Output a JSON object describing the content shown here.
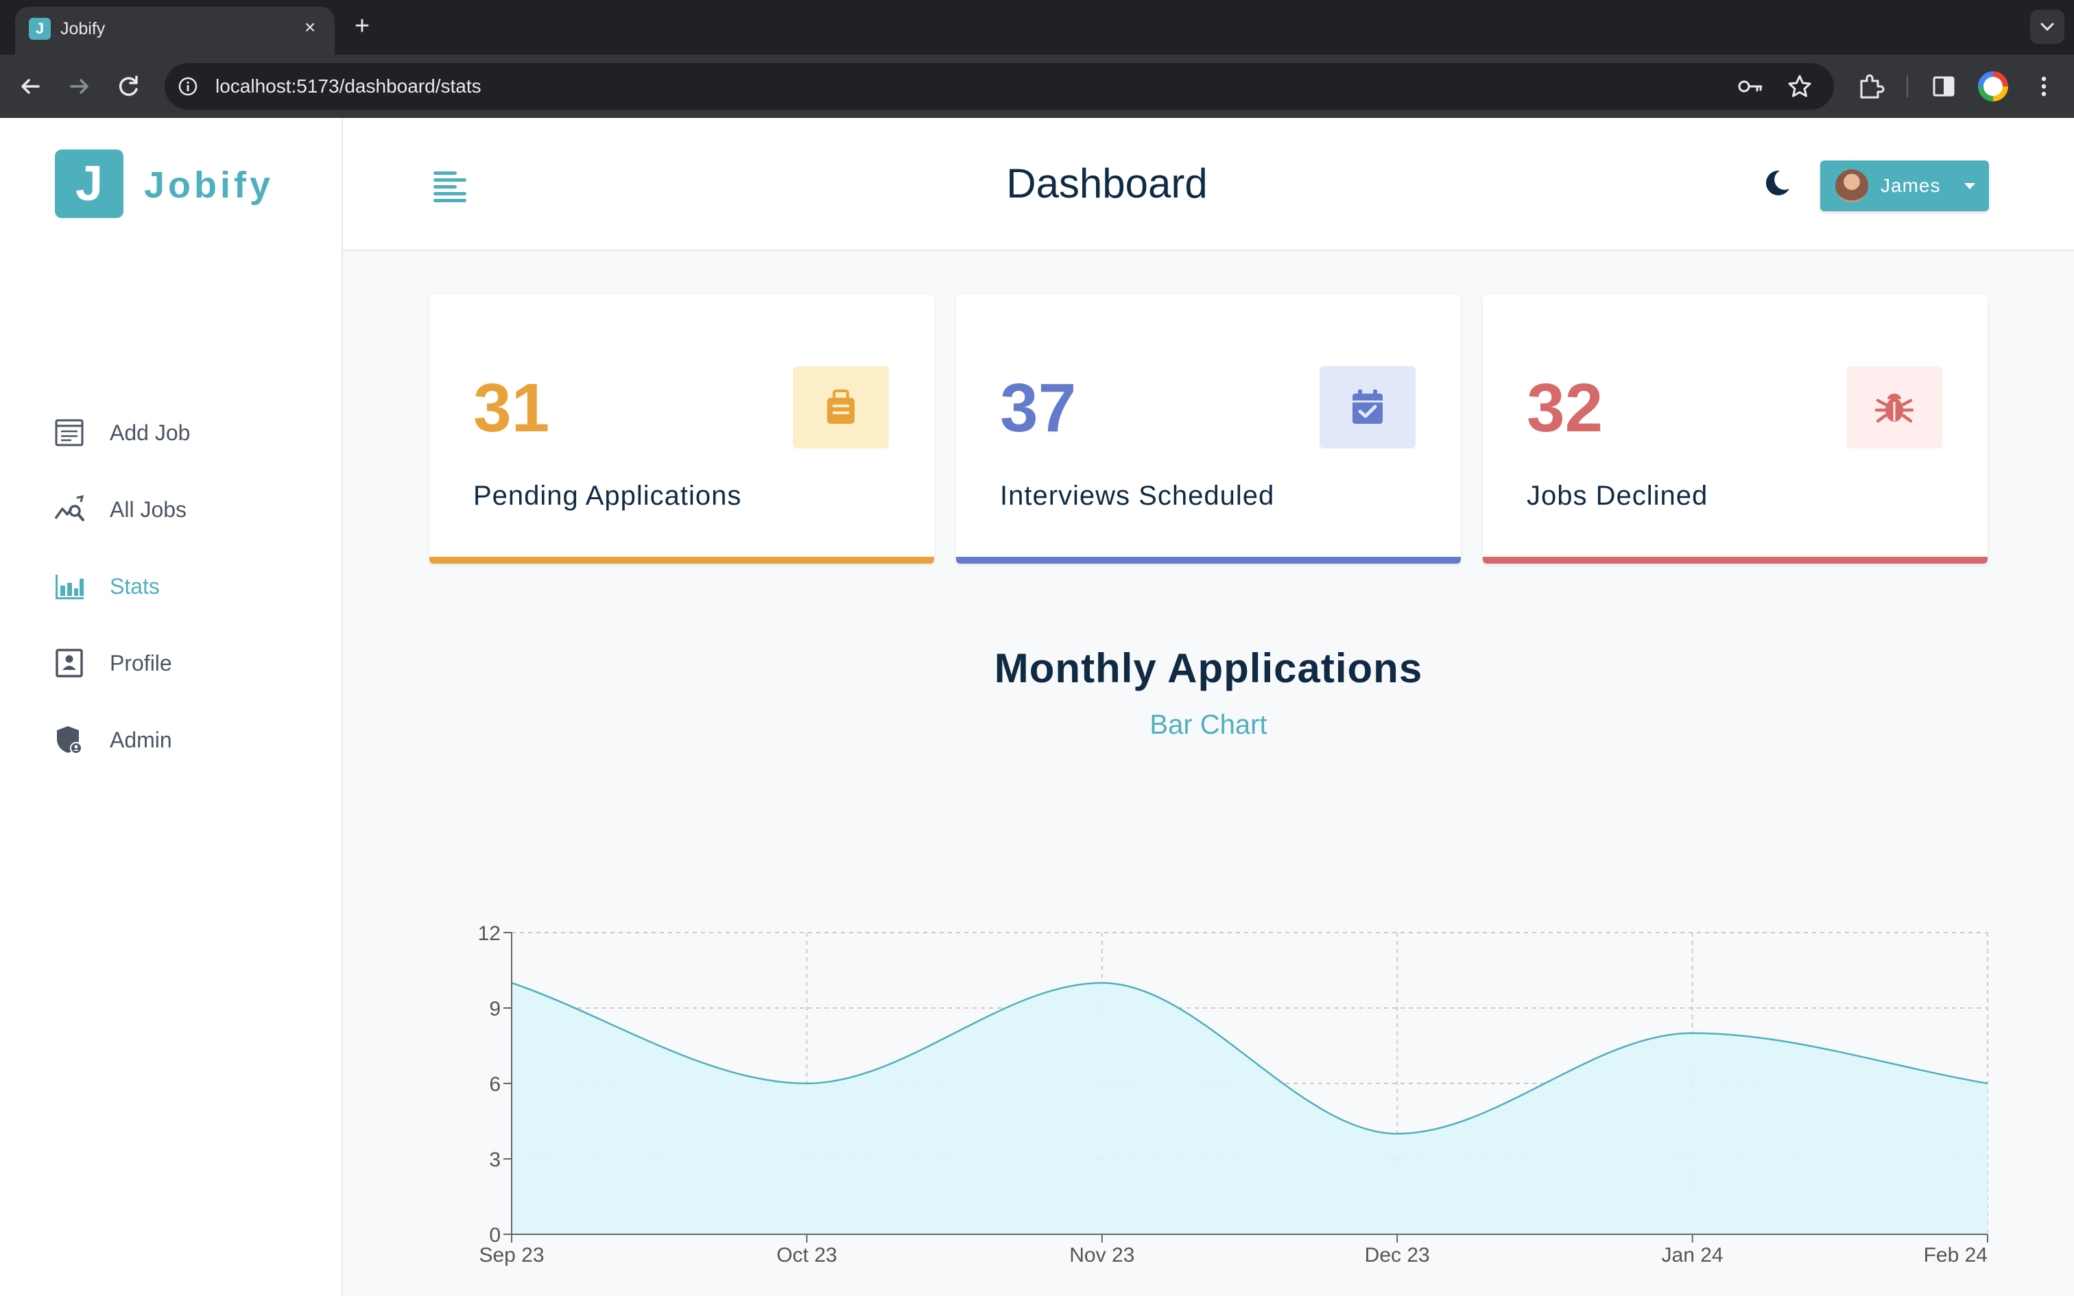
{
  "browser": {
    "tab_title": "Jobify",
    "tab_favicon_letter": "J",
    "tab_close": "×",
    "new_tab": "+",
    "url": "localhost:5173/dashboard/stats"
  },
  "sidebar": {
    "logo_letter": "J",
    "brand": "Jobify",
    "items": [
      {
        "label": "Add Job",
        "icon": "add-job-icon",
        "active": false
      },
      {
        "label": "All Jobs",
        "icon": "all-jobs-icon",
        "active": false
      },
      {
        "label": "Stats",
        "icon": "stats-icon",
        "active": true
      },
      {
        "label": "Profile",
        "icon": "profile-icon",
        "active": false
      },
      {
        "label": "Admin",
        "icon": "admin-icon",
        "active": false
      }
    ]
  },
  "header": {
    "title": "Dashboard",
    "user_name": "James"
  },
  "stats": [
    {
      "count": "31",
      "label": "Pending Applications",
      "color": "#e9a23b",
      "bg": "#fcefc7",
      "icon": "suitcase-icon"
    },
    {
      "count": "37",
      "label": "Interviews Scheduled",
      "color": "#647acb",
      "bg": "#e0e8f9",
      "icon": "calendar-check-icon"
    },
    {
      "count": "32",
      "label": "Jobs Declined",
      "color": "#d66a6a",
      "bg": "#ffeeee",
      "icon": "bug-icon"
    }
  ],
  "chart_section": {
    "title": "Monthly Applications",
    "toggle_label": "Bar Chart"
  },
  "chart_data": {
    "type": "area",
    "categories": [
      "Sep 23",
      "Oct 23",
      "Nov 23",
      "Dec 23",
      "Jan 24",
      "Feb 24"
    ],
    "values": [
      10,
      6,
      10,
      4,
      8,
      6
    ],
    "ylim": [
      0,
      12
    ],
    "yticks": [
      0,
      3,
      6,
      9,
      12
    ],
    "grid": true,
    "stroke_color": "#4fb0bd",
    "fill_color": "#dcf5f9"
  }
}
